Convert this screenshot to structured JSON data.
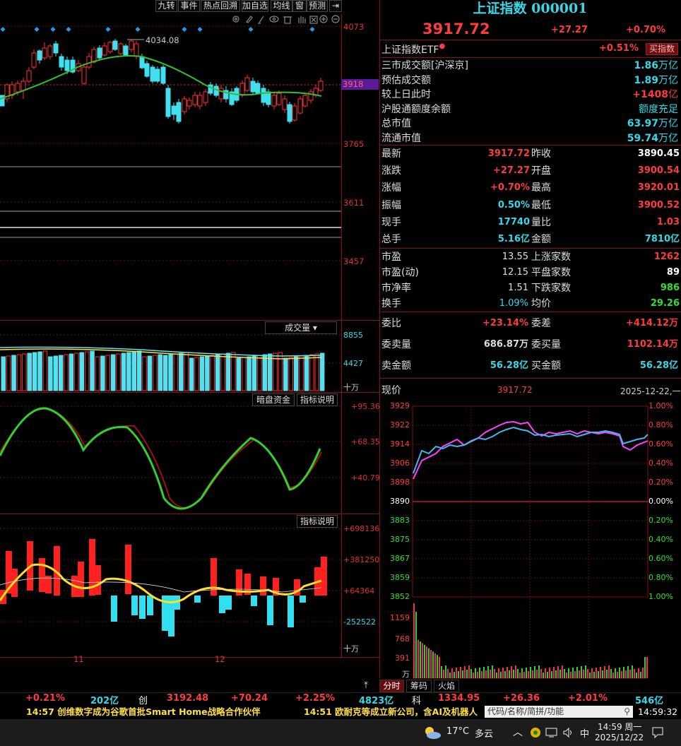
{
  "toolbar": {
    "items": [
      "九转",
      "事件",
      "热点回溯",
      "加自选",
      "均线",
      "窗",
      "预测"
    ],
    "exit_icon": "exit-icon"
  },
  "chart_tools": [
    "settings-icon",
    "draw-icon",
    "pen-icon",
    "eye-icon",
    "trash-icon",
    "hand-icon",
    "delete-icon",
    "zoom-in-icon",
    "zoom-out-icon"
  ],
  "kline": {
    "y_ticks": [
      "4073",
      "3918",
      "3765",
      "3611",
      "3457"
    ],
    "high_label": "4034.08",
    "current_tag": "3918",
    "x_labels": [
      "11",
      "12"
    ]
  },
  "volume": {
    "title": "成交量",
    "y_ticks": [
      "8855",
      "4427",
      "十万"
    ]
  },
  "osc1": {
    "title": "暗盘资金",
    "help": "指标说明",
    "y_ticks": [
      "+95.36",
      "+68.35",
      "+40.79"
    ]
  },
  "osc2": {
    "help": "指标说明",
    "y_ticks": [
      "+698136",
      "+381250",
      "+64364",
      "-252522",
      "十万"
    ]
  },
  "header": {
    "title": "上证指数 000001",
    "price": "3917.72",
    "change": "+27.27",
    "pct": "+0.70%"
  },
  "etf": {
    "label": "上证指数ETF",
    "pct": "+0.51%",
    "buy": "买指数"
  },
  "market_rows": [
    {
      "label": "三市成交额[沪深京]",
      "value": "1.86",
      "unit": "万亿"
    },
    {
      "label": "预估成交额",
      "value": "1.89",
      "unit": "万亿"
    },
    {
      "label": "较上日此时",
      "value": "+1408",
      "unit": "亿"
    },
    {
      "label": "沪股通额度余额",
      "value": "额度充足",
      "unit": ""
    },
    {
      "label": "总市值",
      "value": "63.97",
      "unit": "万亿"
    },
    {
      "label": "流通市值",
      "value": "59.74",
      "unit": "万亿"
    }
  ],
  "quote_rows": [
    [
      "最新",
      "3917.72",
      "昨收",
      "3890.45"
    ],
    [
      "涨跌",
      "+27.27",
      "开盘",
      "3900.54"
    ],
    [
      "涨幅",
      "+0.70%",
      "最高",
      "3920.01"
    ],
    [
      "振幅",
      "0.50%",
      "最低",
      "3900.52"
    ],
    [
      "现手",
      "17740",
      "量比",
      "1.03"
    ],
    [
      "总手",
      "5.16亿",
      "金额",
      "7810亿"
    ]
  ],
  "stats_rows": [
    [
      "市盈",
      "13.55",
      "上涨家数",
      "1262"
    ],
    [
      "市盈(动)",
      "12.15",
      "平盘家数",
      "89"
    ],
    [
      "市净率",
      "1.51",
      "下跌家数",
      "986"
    ],
    [
      "换手",
      "1.09%",
      "均价",
      "29.26"
    ]
  ],
  "order_rows": [
    [
      "委比",
      "+23.14%",
      "委差",
      "+414.12万"
    ],
    [
      "委卖量",
      "686.87万",
      "委买量",
      "1102.14万"
    ],
    [
      "卖金额",
      "56.28亿",
      "买金额",
      "56.28亿"
    ]
  ],
  "intraday": {
    "label": "现价",
    "price": "3917.72",
    "date": "2025-12-22,一",
    "left_ticks": [
      "3929",
      "3922",
      "3914",
      "3906",
      "3898",
      "3890",
      "3883",
      "3875",
      "3867",
      "3859",
      "3852"
    ],
    "right_ticks": [
      "1.00%",
      "0.80%",
      "0.60%",
      "0.40%",
      "0.20%",
      "0.00%",
      "0.20%",
      "0.40%",
      "0.60%",
      "0.80%",
      "1.00%"
    ],
    "vol_ticks": [
      "1159",
      "768",
      "391",
      "万"
    ]
  },
  "tabs": [
    "分时",
    "筹码",
    "火焰"
  ],
  "bottom_bar": {
    "a": "+0.21%",
    "b": "202亿",
    "c_label": "创",
    "c": "3192.48",
    "d": "+70.24",
    "e": "+2.25%",
    "f": "4823亿",
    "g_label": "科",
    "g": "1334.95",
    "h": "+26.36",
    "i": "+2.01%",
    "j": "546亿"
  },
  "news": {
    "n1": "14:57 创维数字成为谷歌首批Smart Home战略合作伙伴",
    "n2": "14:51 欧耐克等成立新公司，含AI及机器人",
    "search_placeholder": "代码/名称/简拼/功能",
    "clock": "14:59:32"
  },
  "taskbar": {
    "temp": "17°C",
    "weather": "多云",
    "ime": "中",
    "time": "14:59 周一",
    "date": "2025/12/22"
  }
}
